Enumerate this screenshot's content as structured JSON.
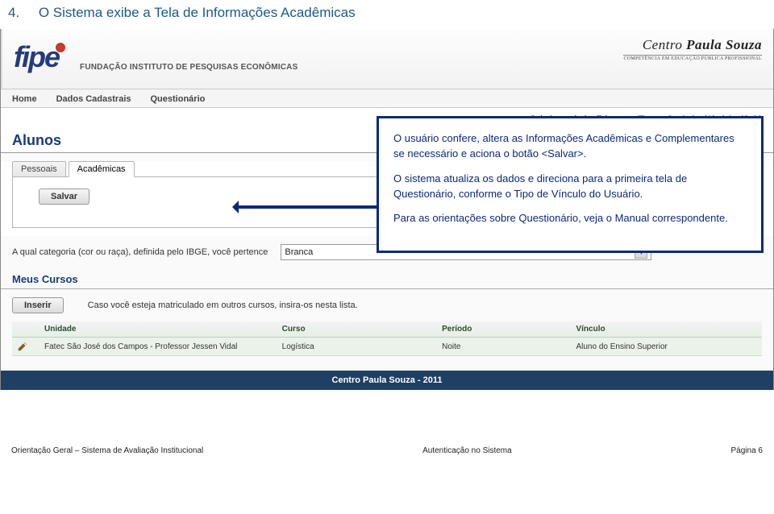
{
  "doc": {
    "heading_num": "4.",
    "heading_text": "O Sistema exibe a Tela de Informações Acadêmicas"
  },
  "banner": {
    "fipe": "fipe",
    "fipe_sub": "FUNDAÇÃO INSTITUTO DE PESQUISAS ECONÔMICAS",
    "cps_line1": "Centro",
    "cps_line2": "Paula Souza",
    "cps_tag": "COMPETÊNCIA EM EDUCAÇÃO PÚBLICA PROFISSIONAL"
  },
  "nav": {
    "items": [
      "Home",
      "Dados Cadastrais",
      "Questionário"
    ]
  },
  "top_links": {
    "welcome": "Seja bem-vindo, Edu",
    "trocar": "(Trocar Senha)",
    "ajuda": "(Ajuda)",
    "sair": "(Sair)"
  },
  "page": {
    "title": "Alunos"
  },
  "tabs": {
    "items": [
      {
        "label": "Pessoais",
        "active": false
      },
      {
        "label": "Acadêmicas",
        "active": true
      }
    ],
    "save_label": "Salvar"
  },
  "question": {
    "text": "A qual categoria (cor ou raça), definida pelo IBGE, você pertence",
    "selected": "Branca"
  },
  "cursos": {
    "heading": "Meus Cursos",
    "insert_label": "Inserir",
    "note": "Caso você esteja matriculado em outros cursos, insira-os nesta lista."
  },
  "table": {
    "headers": [
      "",
      "Unidade",
      "Curso",
      "Período",
      "Vínculo"
    ],
    "rows": [
      {
        "unidade": "Fatec São José dos Campos - Professor Jessen Vidal",
        "curso": "Logística",
        "periodo": "Noite",
        "vinculo": "Aluno do Ensino Superior"
      }
    ]
  },
  "dark_footer": "Centro Paula Souza - 2011",
  "callout": {
    "p1": "O usuário confere, altera as Informações Acadêmicas e Complementares se necessário e aciona o botão <Salvar>.",
    "p2": "O sistema atualiza os dados e direciona para a primeira tela de Questionário, conforme o Tipo de Vínculo do Usuário.",
    "p3": "Para as orientações sobre Questionário, veja o Manual correspondente."
  },
  "doc_footer": {
    "left": "Orientação Geral  –  Sistema de Avaliação Institucional",
    "center": "Autenticação no Sistema",
    "right": "Página 6"
  }
}
